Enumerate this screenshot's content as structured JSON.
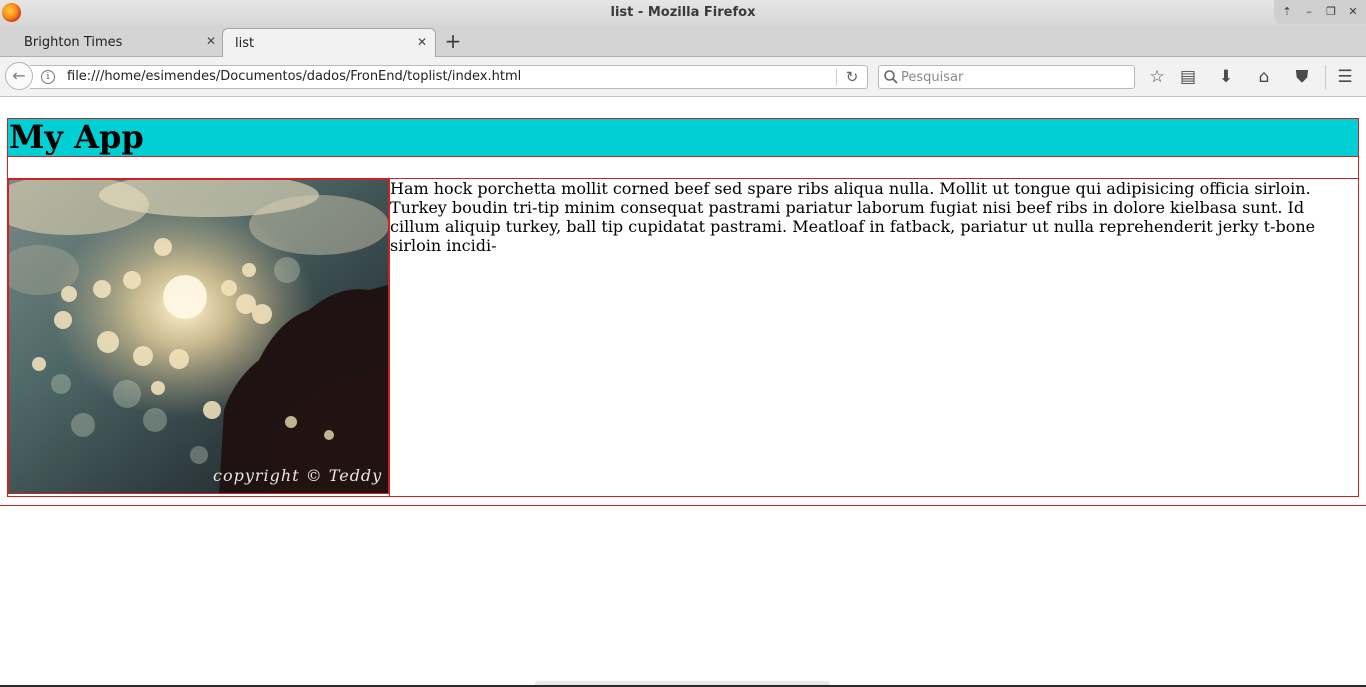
{
  "window": {
    "title": "list - Mozilla Firefox",
    "controls": {
      "up": "⇡",
      "minimize": "–",
      "restore": "❐",
      "close": "✕"
    }
  },
  "tabs": [
    {
      "label": "Brighton Times",
      "close": "✕",
      "active": false
    },
    {
      "label": "list",
      "close": "✕",
      "active": true
    }
  ],
  "new_tab": "+",
  "navbar": {
    "back_icon": "←",
    "info_icon": "i",
    "url": "file:///home/esimendes/Documentos/dados/FronEnd/toplist/index.html",
    "reload_icon": "↻",
    "search": {
      "placeholder": "Pesquisar",
      "value": ""
    },
    "toolbar_icons": {
      "bookmark": "☆",
      "reading_list": "▤",
      "download": "⬇",
      "home": "⌂",
      "pocket": "⛊",
      "menu": "☰"
    }
  },
  "page": {
    "title": "My App",
    "image": {
      "caption": "copyright © Teddy K"
    },
    "body_text": "Ham hock porchetta mollit corned beef sed spare ribs aliqua nulla. Mollit ut tongue qui adipisicing officia sirloin. Turkey boudin tri-tip minim consequat pastrami pariatur laborum fugiat nisi beef ribs in dolore kielbasa sunt. Id cillum aliquip turkey, ball tip cupidatat pastrami. Meatloaf in fatback, pariatur ut nulla reprehenderit jerky t-bone sirloin incidi-"
  },
  "colors": {
    "header_bg": "#00cfd4",
    "border": "#cc2222"
  }
}
